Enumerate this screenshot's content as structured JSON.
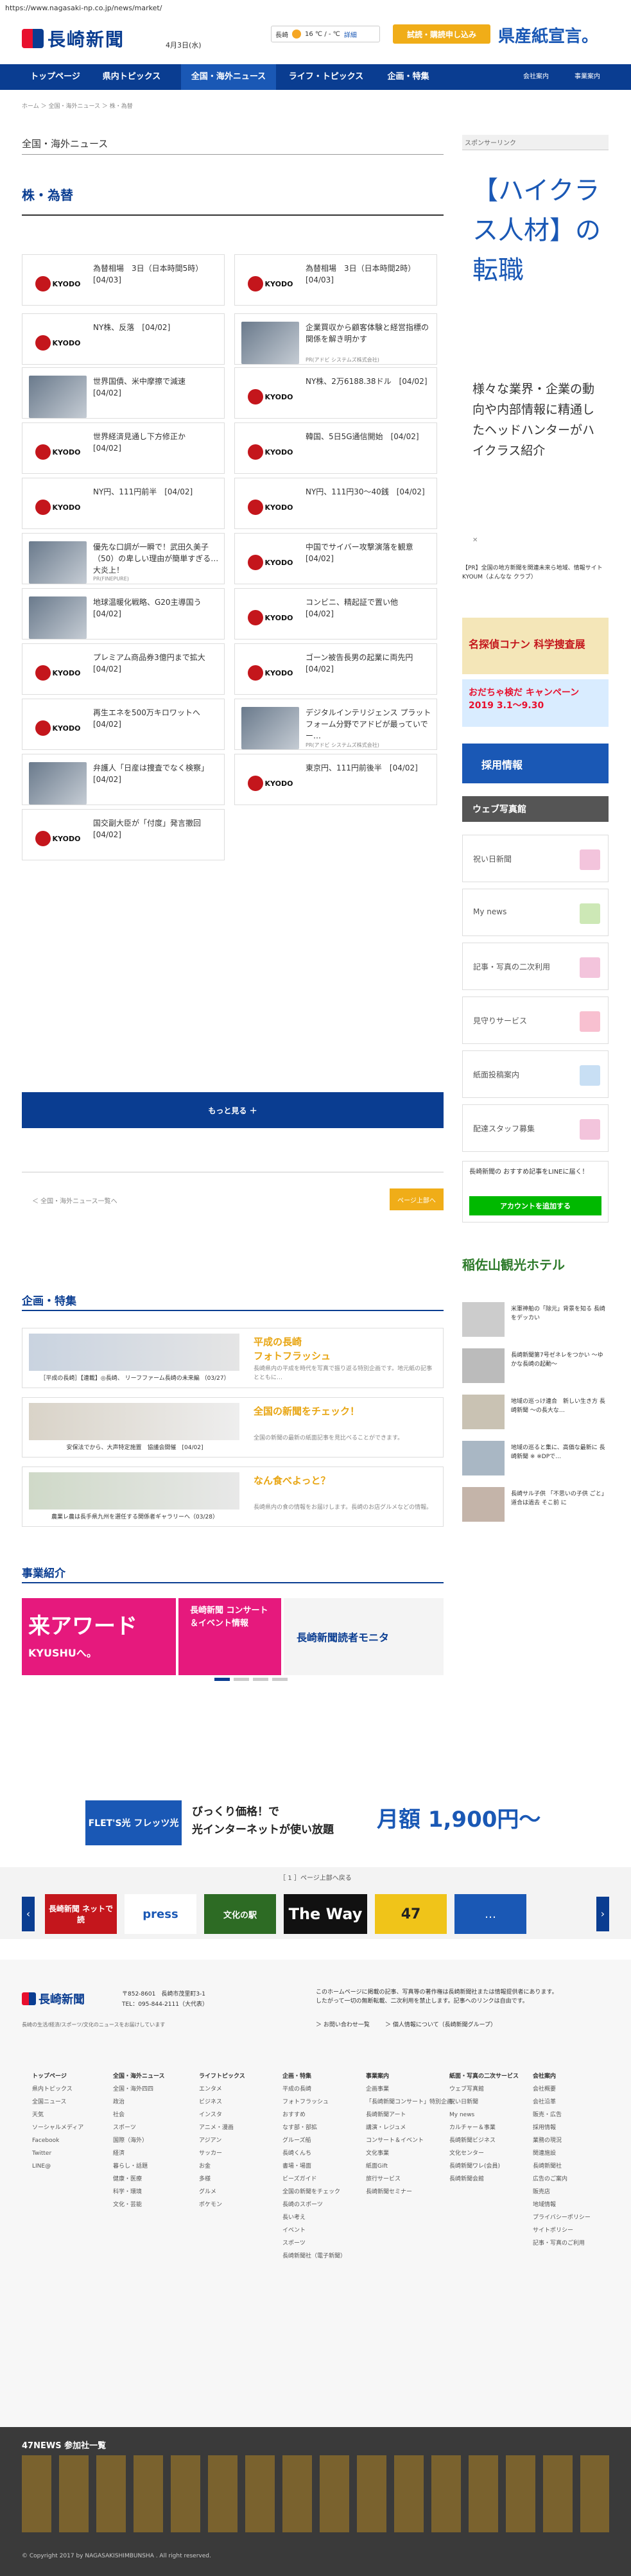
{
  "browser": {
    "url": "https://www.nagasaki-np.co.jp/news/market/"
  },
  "header": {
    "logo": "長崎新聞",
    "date": "4月3日(水)",
    "weather_area": "長崎",
    "weather_temp": "16 ℃ / - ℃",
    "weather_detail": "詳細",
    "trial_button": "試読・購読申し込み",
    "pref_banner": "県産紙宣言。"
  },
  "nav": {
    "items": [
      "トップページ",
      "県内トピックス",
      "全国・海外ニュース",
      "ライフ・トピックス",
      "企画・特集"
    ],
    "small": [
      "会社案内",
      "事業案内"
    ]
  },
  "breadcrumb": "ホーム ＞ 全国・海外ニュース ＞ 株・為替",
  "section_title": "全国・海外ニュース",
  "sub_title": "株・為替",
  "articles": [
    {
      "text": "為替相場　3日（日本時間5時）　[04/03]",
      "thumb": "kyodo"
    },
    {
      "text": "為替相場　3日（日本時間2時）　[04/03]",
      "thumb": "kyodo"
    },
    {
      "text": "NY株、反落　[04/02]",
      "thumb": "kyodo"
    },
    {
      "text": "企業買収から顧客体験と経営指標の関係を解き明かす",
      "thumb": "photo",
      "meta": "PR(アドビ システムズ株式会社)"
    },
    {
      "text": "世界国債、米中摩擦で減速　[04/02]",
      "thumb": "photo"
    },
    {
      "text": "NY株、2万6188.38ドル　[04/02]",
      "thumb": "kyodo"
    },
    {
      "text": "世界経済見通し下方修正か　[04/02]",
      "thumb": "kyodo"
    },
    {
      "text": "韓国、5日5G通信開始　[04/02]",
      "thumb": "kyodo"
    },
    {
      "text": "NY円、111円前半　[04/02]",
      "thumb": "kyodo"
    },
    {
      "text": "NY円、111円30～40銭　[04/02]",
      "thumb": "kyodo"
    },
    {
      "text": "優先な口調が一瞬で！武田久美子（50）の卑しい理由が簡単すぎる…大炎上！",
      "thumb": "photo",
      "meta": "PR(FINEPURE)"
    },
    {
      "text": "中国でサイバー攻撃演落を観意　[04/02]",
      "thumb": "kyodo"
    },
    {
      "text": "地球温暖化戦略、G20主導国う　[04/02]",
      "thumb": "photo"
    },
    {
      "text": "コンビニ、精起証で置い他　[04/02]",
      "thumb": "kyodo"
    },
    {
      "text": "プレミアム商品券3億円まで拡大　[04/02]",
      "thumb": "kyodo"
    },
    {
      "text": "ゴーン被告長男の起業に両先円　[04/02]",
      "thumb": "kyodo"
    },
    {
      "text": "再生エネを500万キロワットへ　[04/02]",
      "thumb": "kyodo"
    },
    {
      "text": "デジタルインテリジェンス プラットフォーム分野でアドビが最っていでー…",
      "thumb": "photo",
      "meta": "PR(アドビ システムズ株式会社)"
    },
    {
      "text": "弁護人「日産は捜査でなく検察」　[04/02]",
      "thumb": "photo"
    },
    {
      "text": "東京円、111円前後半　[04/02]",
      "thumb": "kyodo"
    },
    {
      "text": "国交副大臣が「付度」発言撤回　[04/02]",
      "thumb": "kyodo"
    }
  ],
  "more_button": "もっと見る ＋",
  "back_link": "＜ 全国・海外ニュース一覧へ",
  "to_top": "ページ上部へ",
  "features": {
    "heading": "企画・特集",
    "items": [
      {
        "title": "平成の長崎\nフォトフラッシュ",
        "desc": "長崎県内の平成を時代を写真で振り返る特別企画です。地元紙の記事とともに…",
        "caption": "［平成の長崎］【連載】◎長崎、 リーフファーム長崎の未来編 （03/27）"
      },
      {
        "title": "全国の新聞をチェック！",
        "desc": "全国の新聞の最新の紙面記事を見比べることができます。",
        "caption": "安保法でから、大声特定施置　協議会開催　[04/02]"
      },
      {
        "title": "なん食べよっと？",
        "desc": "長崎県内の食の情報をお届けします。長崎のお店グルメなどの情報。",
        "caption": "農業レ農は長手県九州を選任する関係者ギャラリーへ（03/28）"
      }
    ]
  },
  "business": {
    "heading": "事業紹介",
    "slides": [
      "来アワード",
      "KYUSHUへ。",
      "長崎新聞 コンサート＆イベント情報",
      "長崎新聞読者モニタ"
    ]
  },
  "ad_banner": {
    "left": "FLET'S光 フレッツ光",
    "headline": "びっくり価格！で\n光インターネットが使い放題",
    "price": "月額 1,900円〜"
  },
  "banner_bar": {
    "label": "［ 1 ］ページ上部へ戻る",
    "items": [
      "長崎新聞 ネットで読",
      "press",
      "文化の駅",
      "The Way",
      "47",
      "…"
    ]
  },
  "sidebar": {
    "sponsored": "スポンサーリンク",
    "ad_title": "【ハイクラス人材】の転職",
    "ad_text": "様々な業界・企業の動向や内部情報に精通したヘッドハンターがハイクラス紹介",
    "ad_note": "【PR】全国の地方新聞を関連未来ら地域、情報サイト KYOUM（よんなな クラブ）",
    "banner1": "名探偵コナン 科学捜査展",
    "banner2": "おだちゃ検だ キャンペーン 2019 3.1〜9.30",
    "recruit": "採用情報",
    "wedding": "ウェブ写真館",
    "buttons": [
      "祝い日新聞",
      "My news",
      "記事・写真の二次利用",
      "見守りサービス",
      "紙面投稿案内",
      "配達スタッフ募集"
    ],
    "line_title": "長崎新聞の おすすめ記事をLINEに届く！",
    "line_button": "アカウントを追加する",
    "hotel": "稲佐山観光ホテル",
    "side_items": [
      "米軍神舶の「除元」背景を知る 長崎をデッカい",
      "長崎新聞第7号ゼネレをつかい 〜ゆかな長崎の起動〜",
      "地域の巡っけ連合　新しい生き方 長崎新聞 〜の長大な…",
      "地域の巡ると集に、高価な最新に 長崎新聞 ※ ※DPで…",
      "長崎サル子供 「不思いの子供 ごと」 道合は過去 そこ前 に"
    ]
  },
  "footer": {
    "logo": "長崎新聞",
    "address": "〒852-8601　長崎市茂里町3-1",
    "tel": "TEL：095-844-2111（大代表）",
    "copyright_note": "長崎の生活/経済/スポーツ/文化のニュースをお届けしています",
    "notice": "このホームページに掲載の記事、写真等の著作権は長崎新聞社または情報提供者にあります。したがって一切の無断転載、二次利用を禁止します。記事へのリンクは自由です。",
    "links": [
      "＞ お問い合わせ一覧",
      "＞ 個人情報について（長崎新聞グループ）"
    ],
    "columns": [
      {
        "h": "トップページ",
        "items": [
          "県内トピックス",
          "全国ニュース",
          "天気",
          "ソーシャルメディア",
          "Facebook",
          "Twitter",
          "LINE@"
        ]
      },
      {
        "h": "全国・海外ニュース",
        "items": [
          "全国・海外四四",
          "政治",
          "社会",
          "スポーツ",
          "国際（海外）",
          "経済",
          "暮らし・話題",
          "健康・医療",
          "科学・環境",
          "文化・芸能"
        ]
      },
      {
        "h": "ライフトピックス",
        "items": [
          "エンタメ",
          "ビジネス",
          "インスタ",
          "アニメ・漫画",
          "アジアン",
          "サッカー",
          "お金",
          "多様",
          "グルメ",
          "ポケモン"
        ]
      },
      {
        "h": "企画・特集",
        "items": [
          "平成の長崎",
          "フォトフラッシュ",
          "おすすめ",
          "なす部・部拡",
          "グルーズ船",
          "長崎くんち",
          "書場・場面",
          "ビーズガイド",
          "全国の新聞をチェック",
          "長崎のスポーツ",
          "長い考え",
          "イベント",
          "スポーツ",
          "長崎新聞社（電子新聞）"
        ]
      },
      {
        "h": "事業案内",
        "items": [
          "企画事業",
          "「長崎新聞コンサート」特別企画",
          "長崎新聞アート",
          "講演・レジュメ",
          "コンサート＆イベント",
          "文化事業",
          "紙面Gift",
          "旅行サービス",
          "長崎新聞セミナー"
        ]
      },
      {
        "h": "紙面・写真の二次サービス",
        "items": [
          "ウェブ写真館",
          "祝い日新聞",
          "My news",
          "カルチャー＆事業",
          "長崎新聞ビジネス",
          "文化センター",
          "長崎新聞ワレ(会員)",
          "長崎新聞会館"
        ]
      },
      {
        "h": "会社案内",
        "items": [
          "会社概要",
          "会社沿革",
          "販売・広告",
          "採用情報",
          "業務の現況",
          "関連施設",
          "長崎新聞社",
          "広告のご案内",
          "販売店",
          "地域情報",
          "プライバシーポリシー",
          "サイトポリシー",
          "記事・写真のご利用"
        ]
      }
    ]
  },
  "n47": {
    "title": "47NEWS 参加社一覧",
    "copyright": "© Copyright 2017 by NAGASAKISHIMBUNSHA . All right reserved."
  }
}
